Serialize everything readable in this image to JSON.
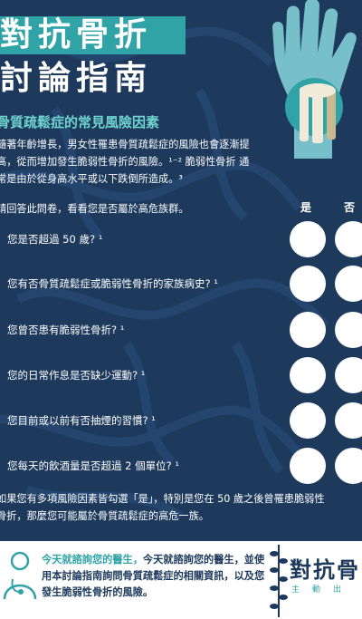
{
  "title": {
    "line1": "對抗骨折",
    "line2": "討論指南"
  },
  "section_heading": "骨質疏鬆症的常見風險因素",
  "intro_lines": [
    "隨著年齡增長，男女性罹患骨質疏鬆症的風險也會逐漸提",
    "高，從而增加發生脆弱性骨折的風險。¹⁻² 脆弱性骨折 通",
    "常是由於從身高水平或以下跌倒所造成。³"
  ],
  "instruction": "請回答此問卷，看看您是否屬於高危族群。",
  "columns": {
    "yes": "是",
    "no": "否"
  },
  "questions": [
    {
      "text": "您是否超過 50 歲? ¹"
    },
    {
      "text": "您有否骨質疏鬆症或脆弱性骨折的家族病史? ¹"
    },
    {
      "text": "您曾否患有脆弱性骨折? ¹"
    },
    {
      "text": "您的日常作息是否缺少運動? ¹"
    },
    {
      "text": "您目前或以前有否抽煙的習慣? ¹"
    },
    {
      "text": "您每天的飲酒量是否超過 2 個單位? ¹"
    }
  ],
  "conclusion_lines": [
    "如果您有多項風險因素皆勾選「是」，特別是您在 50 歲之後曾罹患脆弱性",
    "骨折，那麼您可能屬於骨質疏鬆症的高危一族。"
  ],
  "footer": {
    "accent_text": "今天就諮詢您的醫生，",
    "body_text": "今天就諮詢您的醫生，並使用本討論指南詢問骨質疏鬆症的相關資訊，以及您發生脆弱性骨折的風險。",
    "brand": "對抗骨",
    "brand_sub": "主動出"
  },
  "colors": {
    "background": "#1d3a5c",
    "accent": "#2fa3a6",
    "heading": "#6ed3cf"
  }
}
